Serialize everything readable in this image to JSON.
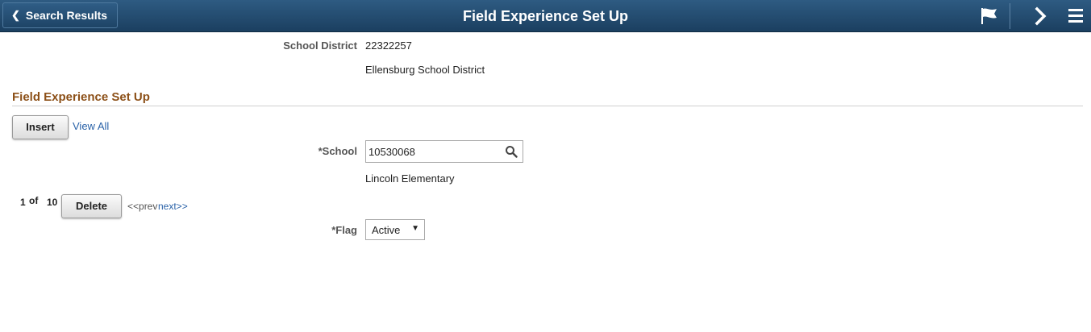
{
  "header": {
    "back_label": "Search Results",
    "title": "Field Experience Set Up",
    "icons": [
      "back-chevron-icon",
      "flag-icon",
      "next-chevron-icon",
      "menu-icon"
    ],
    "bar_color": "#24507a"
  },
  "district": {
    "label": "School District",
    "value": "22322257",
    "name": "Ellensburg School District"
  },
  "section": {
    "title": "Field Experience Set Up",
    "title_color": "#8c5018",
    "insert_label": "Insert",
    "view_all_label": "View All"
  },
  "school": {
    "label": "*School",
    "value": "10530068",
    "name": "Lincoln Elementary"
  },
  "pager": {
    "current": "1",
    "of_label": "of",
    "total": "10",
    "delete_label": "Delete",
    "prev_label": "<<prev",
    "next_label": "next>>"
  },
  "flag": {
    "label": "*Flag",
    "selected": "Active"
  },
  "link_color": "#2a62a8"
}
